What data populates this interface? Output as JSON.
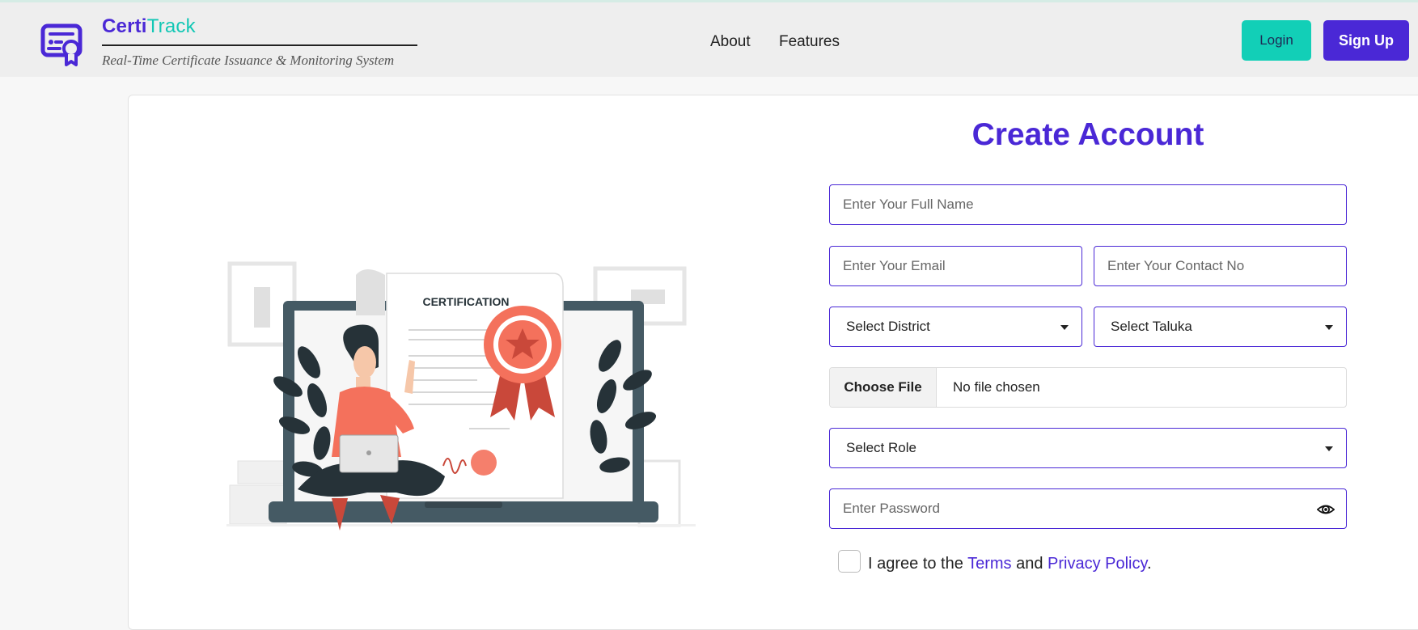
{
  "brand": {
    "name_part1": "Certi",
    "name_part2": "Track",
    "tagline": "Real-Time Certificate Issuance & Monitoring System"
  },
  "nav": {
    "links": [
      "About",
      "Features"
    ],
    "login_label": "Login",
    "signup_label": "Sign Up"
  },
  "illustration": {
    "certificate_heading": "CERTIFICATION"
  },
  "form": {
    "title": "Create Account",
    "full_name_placeholder": "Enter Your Full Name",
    "email_placeholder": "Enter Your Email",
    "contact_placeholder": "Enter Your Contact No",
    "district_selected": "Select District",
    "taluka_selected": "Select Taluka",
    "file_button_label": "Choose File",
    "file_status": "No file chosen",
    "role_selected": "Select Role",
    "password_placeholder": "Enter Password",
    "agree_prefix": "I agree to the",
    "terms_label": "Terms",
    "agree_and": "and",
    "privacy_label": "Privacy Policy",
    "agree_suffix": "."
  },
  "colors": {
    "primary": "#4a28d6",
    "accent": "#12cfb7",
    "illustration_accent": "#f4715c"
  }
}
